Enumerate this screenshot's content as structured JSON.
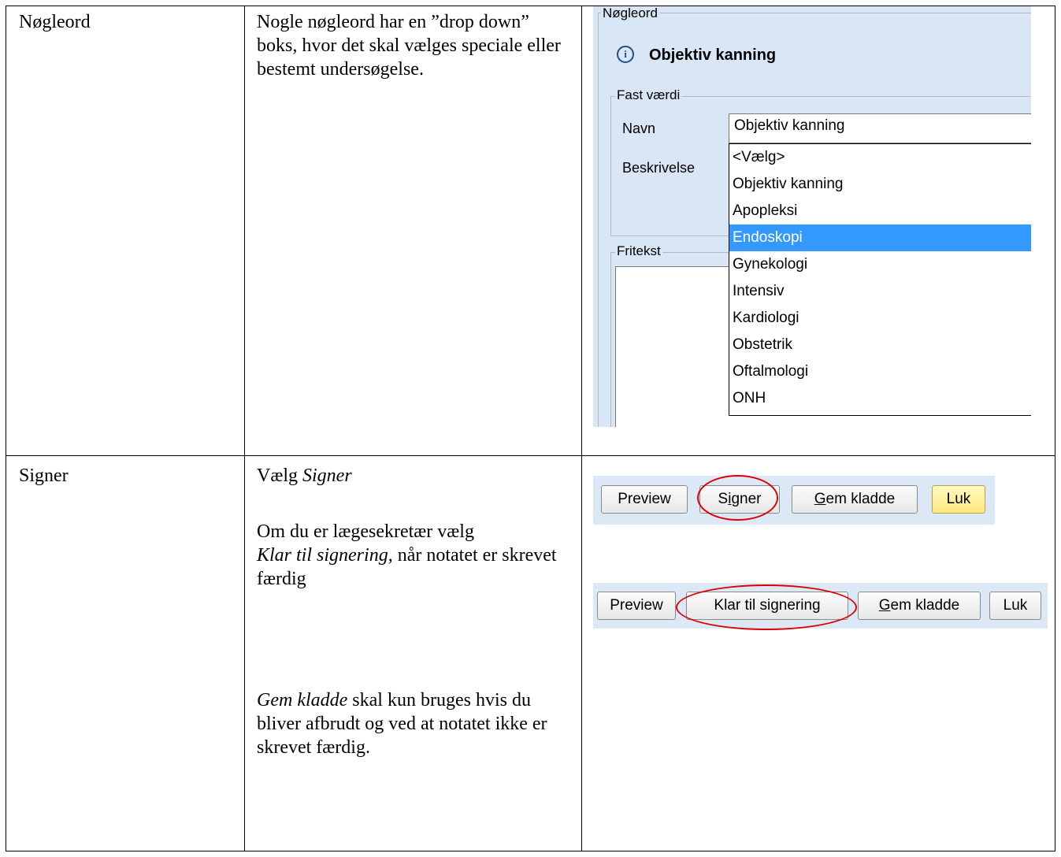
{
  "rows": [
    {
      "term": "Nøgleord",
      "description": "Nogle nøgleord har en ”drop down” boks, hvor det skal vælges speciale eller bestemt undersøgelse.",
      "shot": {
        "legend": "Nøgleord",
        "title": "Objektiv kanning",
        "fieldset_label": "Fast værdi",
        "name_label": "Navn",
        "name_value": "Objektiv kanning",
        "desc_label": "Beskrivelse",
        "freetext_label": "Fritekst",
        "dropdown_options": [
          "<Vælg>",
          "Objektiv kanning",
          "Apopleksi",
          "Endoskopi",
          "Gynekologi",
          "Intensiv",
          "Kardiologi",
          "Obstetrik",
          "Oftalmologi",
          "ONH"
        ],
        "dropdown_selected": "Endoskopi"
      }
    },
    {
      "term": "Signer",
      "p1_prefix": "Vælg ",
      "p1_em": "Signer",
      "p2_em": "Klar til signering,",
      "p2_before": "Om du er lægesekretær vælg",
      "p2_after": " når notatet er skrevet færdig",
      "p3_em": "Gem kladde",
      "p3_text": " skal kun bruges hvis du bliver afbrudt og ved at notatet ikke er skrevet færdig.",
      "bar1": {
        "preview": "Preview",
        "signer": "Signer",
        "gem": "Gem kladde",
        "luk": "Luk"
      },
      "bar2": {
        "preview": "Preview",
        "klar": "Klar til signering",
        "gem": "Gem kladde",
        "luk": "Luk"
      }
    }
  ]
}
